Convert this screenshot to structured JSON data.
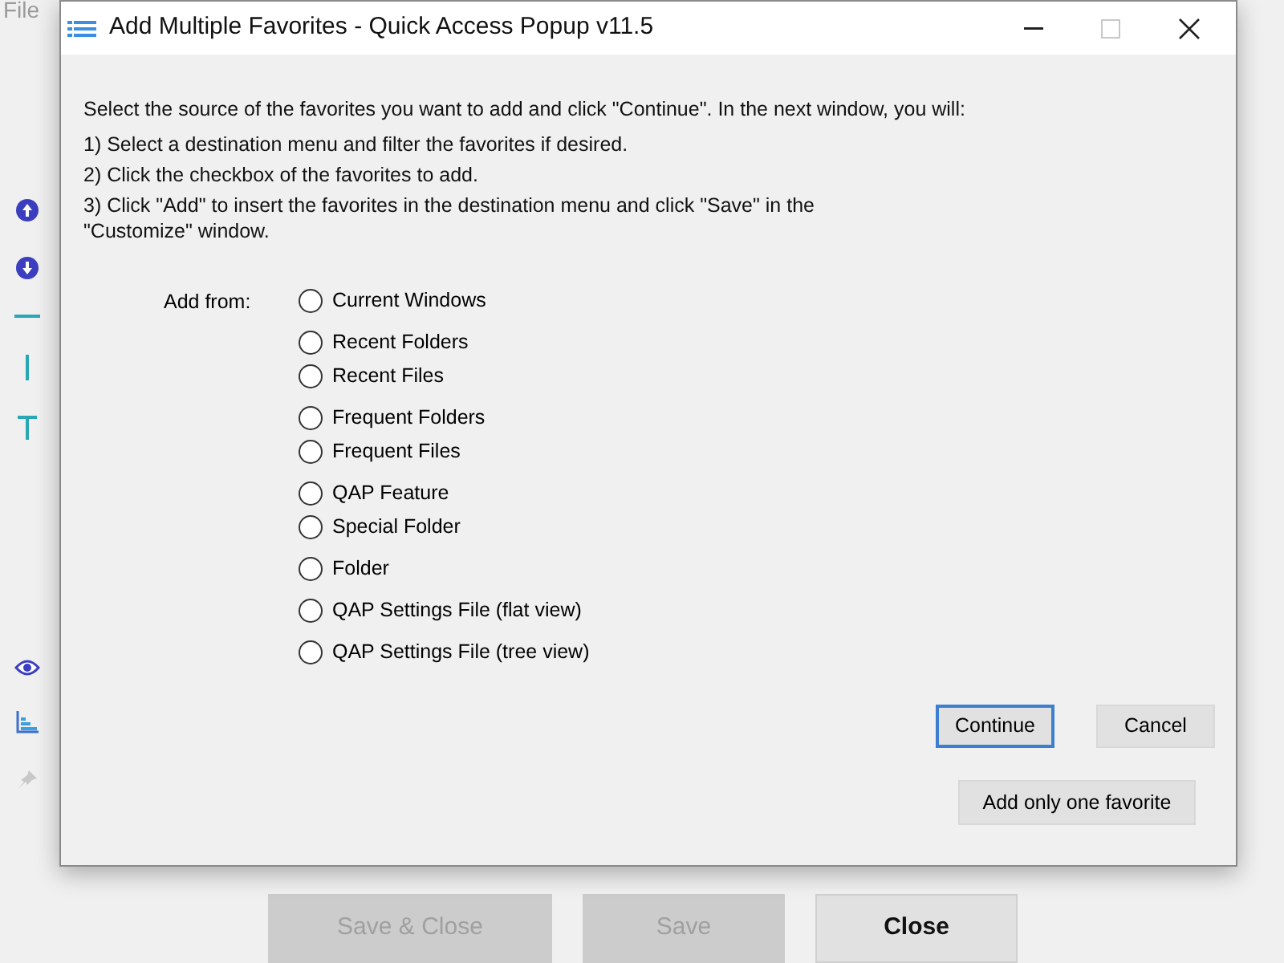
{
  "background_window": {
    "menu": [
      "File"
    ],
    "toolbar_icons": [
      {
        "kind": "up"
      },
      {
        "kind": "down"
      },
      {
        "kind": "hline"
      },
      {
        "kind": "vline"
      },
      {
        "kind": "t"
      },
      {
        "kind": "eye"
      },
      {
        "kind": "chart"
      },
      {
        "kind": "pin"
      }
    ],
    "buttons": [
      {
        "label": "Save & Close",
        "disabled": true
      },
      {
        "label": "Save",
        "disabled": true
      },
      {
        "label": "Close",
        "disabled": false
      }
    ]
  },
  "dialog": {
    "title": "Add Multiple Favorites - Quick Access Popup v11.5",
    "intro": "Select the source of the favorites you want to add and click \"Continue\". In the next window, you will:",
    "steps": [
      "1) Select a destination menu and filter the favorites if desired.",
      "2) Click the checkbox of the favorites to add.",
      "3) Click \"Add\" to insert the favorites in the destination menu and click \"Save\" in the \"Customize\" window."
    ],
    "add_from_label": "Add from:",
    "option_groups": [
      [
        {
          "label": "Current Windows",
          "selected": false
        }
      ],
      [
        {
          "label": "Recent Folders",
          "selected": false
        },
        {
          "label": "Recent Files",
          "selected": false
        }
      ],
      [
        {
          "label": "Frequent Folders",
          "selected": false
        },
        {
          "label": "Frequent Files",
          "selected": false
        }
      ],
      [
        {
          "label": "QAP Feature",
          "selected": false
        },
        {
          "label": "Special Folder",
          "selected": false
        }
      ],
      [
        {
          "label": "Folder",
          "selected": false
        }
      ],
      [
        {
          "label": "QAP Settings File (flat view)",
          "selected": false
        }
      ],
      [
        {
          "label": "QAP Settings File (tree view)",
          "selected": false
        }
      ]
    ],
    "buttons": [
      {
        "label": "Continue",
        "default": true
      },
      {
        "label": "Cancel",
        "default": false
      }
    ],
    "single_button": "Add only one favorite"
  }
}
